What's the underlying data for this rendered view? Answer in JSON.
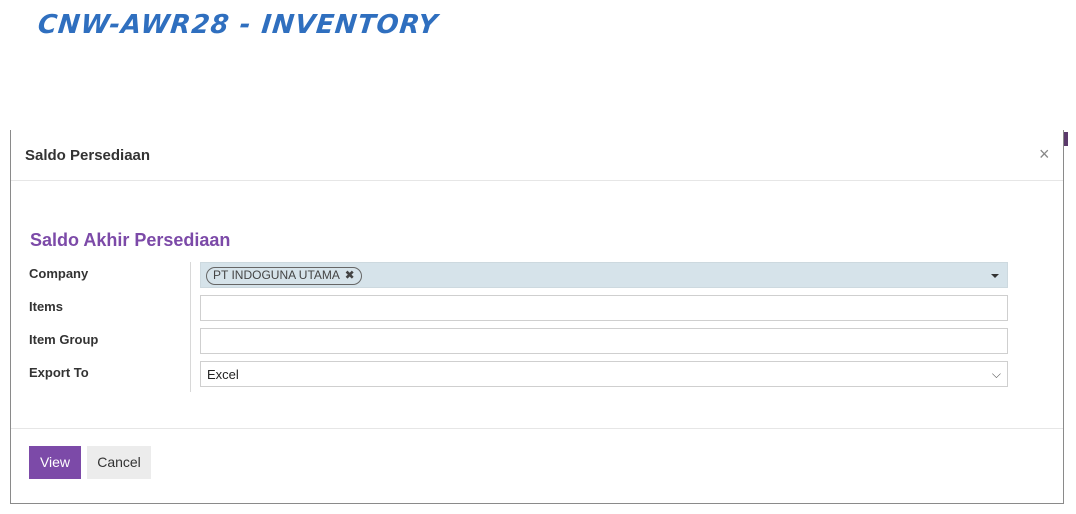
{
  "annotation": {
    "title": "CNW-AWR28 - INVENTORY"
  },
  "modal": {
    "title": "Saldo Persediaan",
    "close_glyph": "×",
    "section_title": "Saldo Akhir Persediaan",
    "fields": {
      "company": {
        "label": "Company",
        "tag": "PT INDOGUNA UTAMA",
        "tag_remove_glyph": "✖"
      },
      "items": {
        "label": "Items",
        "value": ""
      },
      "item_group": {
        "label": "Item Group",
        "value": ""
      },
      "export_to": {
        "label": "Export To",
        "value": "Excel",
        "chevron": "⌵"
      }
    },
    "buttons": {
      "view": "View",
      "cancel": "Cancel"
    }
  },
  "colors": {
    "accent": "#7c4aa8",
    "annotation": "#2f6fbf",
    "company_field_bg": "#d6e3ea"
  }
}
